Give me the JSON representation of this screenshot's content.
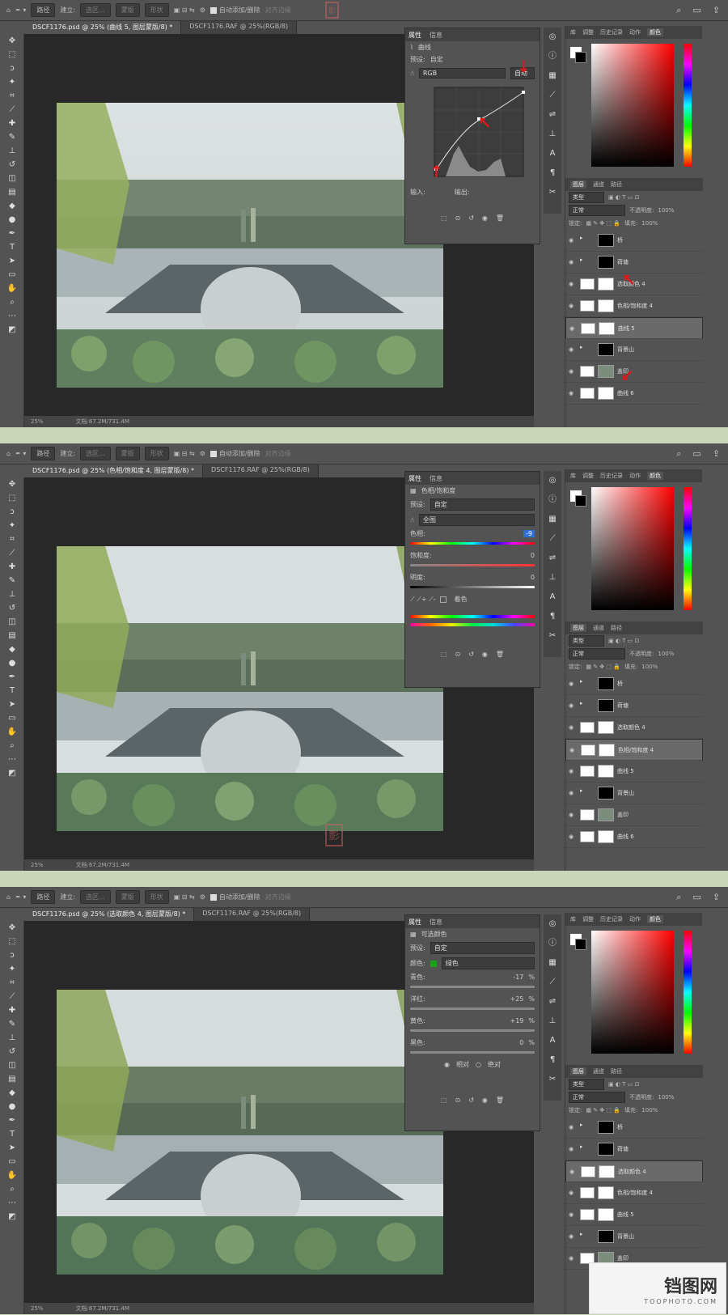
{
  "shots": [
    {
      "tab_active": "DSCF1176.psd @ 25% (曲线 5, 图层蒙版/8) *",
      "tab_other": "DSCF1176.RAF @ 25%(RGB/8)",
      "panel_title": "曲线",
      "preset_label": "预设:",
      "preset_value": "自定",
      "channel": "RGB",
      "auto_btn": "自动",
      "input_label": "输入:",
      "output_label": "输出:",
      "layers": [
        {
          "name": "桥",
          "mask": "shape"
        },
        {
          "name": "荷塘",
          "mask": "black"
        },
        {
          "name": "选取颜色 4",
          "mask": "white"
        },
        {
          "name": "色相/饱和度 4",
          "mask": "white"
        },
        {
          "name": "曲线 5",
          "mask": "white",
          "selected": true
        },
        {
          "name": "背景山",
          "mask": "shape"
        },
        {
          "name": "盖印",
          "mask": "none"
        },
        {
          "name": "曲线 6",
          "mask": "white"
        }
      ]
    },
    {
      "tab_active": "DSCF1176.psd @ 25% (色相/饱和度 4, 图层蒙版/8) *",
      "tab_other": "DSCF1176.RAF @ 25%(RGB/8)",
      "panel_title": "色相/饱和度",
      "preset_label": "预设:",
      "preset_value": "自定",
      "range": "全图",
      "hue_label": "色相:",
      "hue_value": "-9",
      "sat_label": "饱和度:",
      "sat_value": "0",
      "light_label": "明度:",
      "light_value": "0",
      "colorize": "着色",
      "layers": [
        {
          "name": "桥",
          "mask": "shape"
        },
        {
          "name": "荷塘",
          "mask": "black"
        },
        {
          "name": "选取颜色 4",
          "mask": "white"
        },
        {
          "name": "色相/饱和度 4",
          "mask": "white",
          "selected": true
        },
        {
          "name": "曲线 5",
          "mask": "white"
        },
        {
          "name": "背景山",
          "mask": "shape"
        },
        {
          "name": "盖印",
          "mask": "none"
        },
        {
          "name": "曲线 6",
          "mask": "white"
        }
      ]
    },
    {
      "tab_active": "DSCF1176.psd @ 25% (选取颜色 4, 图层蒙版/8) *",
      "tab_other": "DSCF1176.RAF @ 25%(RGB/8)",
      "panel_title": "可选颜色",
      "preset_label": "预设:",
      "preset_value": "自定",
      "color_label": "颜色:",
      "color_value": "绿色",
      "cyan_label": "青色:",
      "cyan_value": "-17",
      "magenta_label": "洋红:",
      "magenta_value": "+25",
      "yellow_label": "黄色:",
      "yellow_value": "+19",
      "black_label": "黑色:",
      "black_value": "0",
      "relative": "相对",
      "absolute": "绝对",
      "layers": [
        {
          "name": "桥",
          "mask": "shape"
        },
        {
          "name": "荷塘",
          "mask": "black"
        },
        {
          "name": "选取颜色 4",
          "mask": "white",
          "selected": true
        },
        {
          "name": "色相/饱和度 4",
          "mask": "white"
        },
        {
          "name": "曲线 5",
          "mask": "white"
        },
        {
          "name": "背景山",
          "mask": "shape"
        },
        {
          "name": "盖印",
          "mask": "none"
        }
      ]
    }
  ],
  "common": {
    "path_mode": "路径",
    "build_label": "建立:",
    "selection_btn": "选区...",
    "mask_btn": "蒙版",
    "shape_btn": "形状",
    "auto_add": "自动添加/删除",
    "align_edges": "对齐边缘",
    "props_tab": "属性",
    "info_tab": "信息",
    "lib_tab": "库",
    "adjust_tab": "调整",
    "history_tab": "历史记录",
    "actions_tab": "动作",
    "color_tab": "颜色",
    "layers_tab": "图层",
    "channels_tab": "通道",
    "paths_tab": "路径",
    "kind_filter": "类型",
    "blend_mode": "正常",
    "opacity_label": "不透明度:",
    "opacity_value": "100%",
    "lock_label": "锁定:",
    "fill_label": "填充:",
    "fill_value": "100%",
    "zoom": "25%",
    "doc_info": "文档:67.2M/731.4M"
  },
  "footer": {
    "logo": "铛图网",
    "url": "TOOPHOTO.COM"
  }
}
